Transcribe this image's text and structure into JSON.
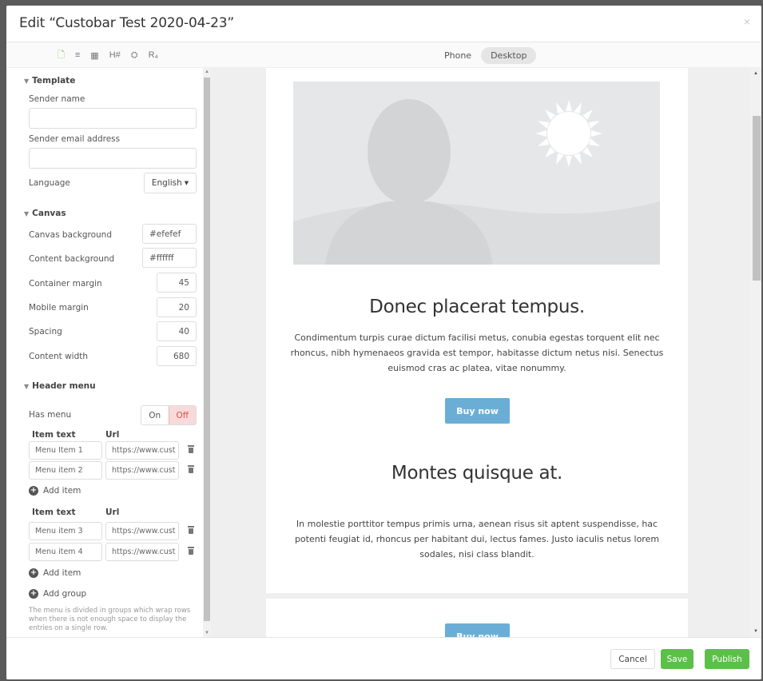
{
  "modal": {
    "title": "Edit “Custobar Test 2020-04-23”",
    "close": "×"
  },
  "toolbar": {
    "tools": [
      {
        "icon": "page-icon",
        "glyph": "🗋"
      },
      {
        "icon": "lines-icon",
        "glyph": "≡"
      },
      {
        "icon": "grid-icon",
        "glyph": "▦"
      },
      {
        "icon": "heading-icon",
        "glyph": "H#"
      },
      {
        "icon": "settings-icon",
        "glyph": "⛭"
      },
      {
        "icon": "translate-icon",
        "glyph": "R₄"
      }
    ],
    "views": {
      "phone": "Phone",
      "desktop": "Desktop"
    }
  },
  "sidebar": {
    "template": {
      "title": "Template",
      "sender_name_label": "Sender name",
      "sender_name_value": "",
      "sender_email_label": "Sender email address",
      "sender_email_value": "",
      "language_label": "Language",
      "language_value": "English"
    },
    "canvas": {
      "title": "Canvas",
      "canvas_bg_label": "Canvas background",
      "canvas_bg_value": "#efefef",
      "content_bg_label": "Content background",
      "content_bg_value": "#ffffff",
      "container_margin_label": "Container margin",
      "container_margin_value": "45",
      "mobile_margin_label": "Mobile margin",
      "mobile_margin_value": "20",
      "spacing_label": "Spacing",
      "spacing_value": "40",
      "content_width_label": "Content width",
      "content_width_value": "680"
    },
    "header_menu": {
      "title": "Header menu",
      "has_menu_label": "Has menu",
      "on_label": "On",
      "off_label": "Off",
      "col_item_text": "Item text",
      "col_url": "Url",
      "group1": [
        {
          "text": "Menu Item 1",
          "url": "https://www.cust"
        },
        {
          "text": "Menu item 2",
          "url": "https://www.cust"
        }
      ],
      "group2": [
        {
          "text": "Menu item 3",
          "url": "https://www.cust"
        },
        {
          "text": "Menu item 4",
          "url": "https://www.cust"
        }
      ],
      "add_item": "Add item",
      "add_group": "Add group",
      "help": "The menu is divided in groups which wrap rows when there is not enough space to display the entries on a single row."
    }
  },
  "preview": {
    "heading1": "Donec placerat tempus.",
    "para1": "Condimentum turpis curae dictum facilisi metus, conubia egestas torquent elit nec rhoncus, nibh hymenaeos gravida est tempor, habitasse dictum netus nisi. Senectus euismod cras ac platea, vitae nonummy.",
    "button1": "Buy now",
    "heading2": "Montes quisque at.",
    "para2": "In molestie porttitor tempus primis urna, aenean risus sit aptent suspendisse, hac potenti feugiat id, rhoncus per habitant dui, lectus fames. Justo iaculis netus lorem sodales, nisi class blandit.",
    "button2": "Buy now"
  },
  "footer": {
    "cancel": "Cancel",
    "save": "Save",
    "publish": "Publish"
  },
  "colors": {
    "accent_green": "#5cbf4a",
    "button_blue": "#6aaed6",
    "canvas_bg": "#efefef",
    "toggle_off_bg": "#f9dada"
  }
}
